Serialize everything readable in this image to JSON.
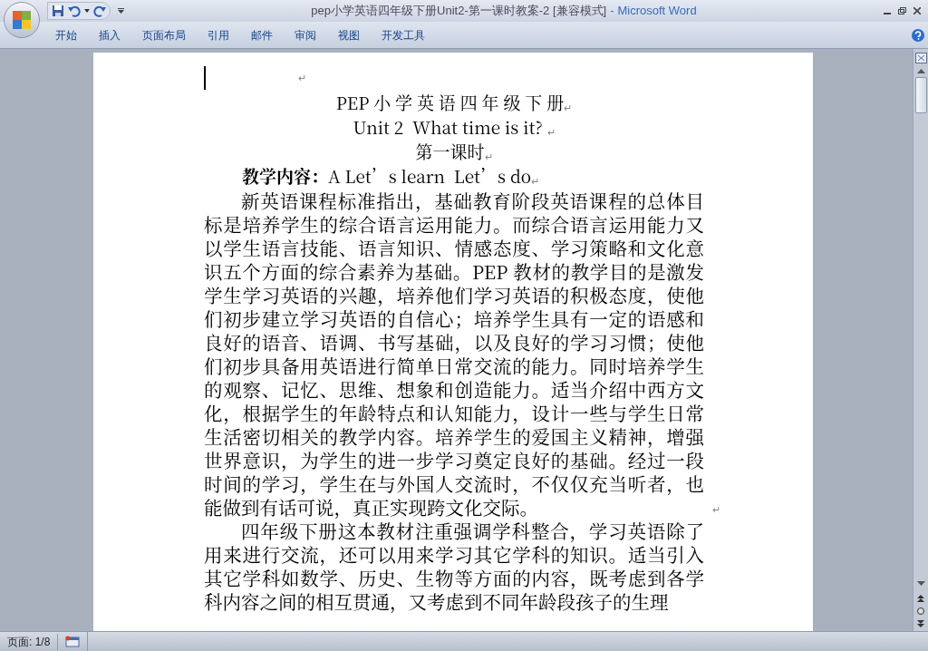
{
  "window": {
    "title": "pep小学英语四年级下册Unit2-第一课时教案-2 [兼容模式]",
    "separator": "-",
    "app_name": "Microsoft Word"
  },
  "ribbon_tabs": [
    "开始",
    "插入",
    "页面布局",
    "引用",
    "邮件",
    "审阅",
    "视图",
    "开发工具"
  ],
  "document": {
    "empty_line_mark": "↵",
    "headings": [
      {
        "text": "PEP 小 学 英 语 四 年 级 下 册",
        "end_mark": "↵"
      },
      {
        "text": "Unit 2  What time is it? ",
        "end_mark": "↵"
      },
      {
        "text": "第一课时",
        "end_mark": "↵"
      }
    ],
    "content_line": {
      "label": "教学内容：",
      "text": "A Let’s learn  Let’s do",
      "end_mark": "↵"
    },
    "paragraphs": [
      {
        "text": "新英语课程标准指出，基础教育阶段英语课程的总体目标是培养学生的综合语言运用能力。而综合语言运用能力又以学生语言技能、语言知识、情感态度、学习策略和文化意识五个方面的综合素养为基础。PEP 教材的教学目的是激发学生学习英语的兴趣，培养他们学习英语的积极态度，使他们初步建立学习英语的自信心；培养学生具有一定的语感和良好的语音、语调、书写基础，以及良好的学习习惯；使他们初步具备用英语进行简单日常交流的能力。同时培养学生的观察、记忆、思维、想象和创造能力。适当介绍中西方文化，根据学生的年龄特点和认知能力，设计一些与学生日常生活密切相关的教学内容。培养学生的爱国主义精神，增强世界意识，为学生的进一步学习奠定良好的基础。经过一段时间的学习，学生在与外国人交流时，不仅仅充当听者，也能做到有话可说，真正实现跨文化交际。",
        "end_mark": "↵"
      },
      {
        "text": "四年级下册这本教材注重强调学科整合，学习英语除了用来进行交流，还可以用来学习其它学科的知识。适当引入其它学科如数学、历史、生物等方面的内容，既考虑到各学科内容之间的相互贯通，又考虑到不同年龄段孩子的生理"
      }
    ]
  },
  "status_bar": {
    "page": "页面: 1/8"
  }
}
